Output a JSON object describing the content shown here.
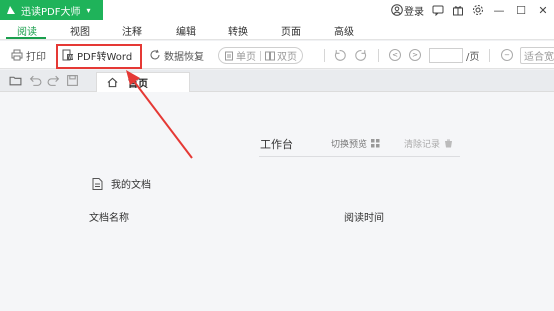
{
  "app": {
    "name": "迅读PDF大师",
    "brand_color": "#1fb35a",
    "login_label": "登录"
  },
  "menu": {
    "items": [
      "阅读",
      "视图",
      "注释",
      "编辑",
      "转换",
      "页面",
      "高级"
    ],
    "active": "阅读"
  },
  "toolbar": {
    "print_label": "打印",
    "pdf_to_word_label": "PDF转Word",
    "data_recovery_label": "数据恢复",
    "single_page_label": "单页",
    "double_page_label": "双页",
    "page_suffix": "/页",
    "fit_label": "适合宽"
  },
  "tabs": {
    "home_label": "首页"
  },
  "workspace": {
    "title": "工作台",
    "switch_preview_label": "切换预览",
    "clear_record_label": "清除记录",
    "my_docs_label": "我的文档",
    "columns": {
      "name": "文档名称",
      "read_time": "阅读时间"
    }
  },
  "annotation": {
    "color": "#e53935"
  }
}
